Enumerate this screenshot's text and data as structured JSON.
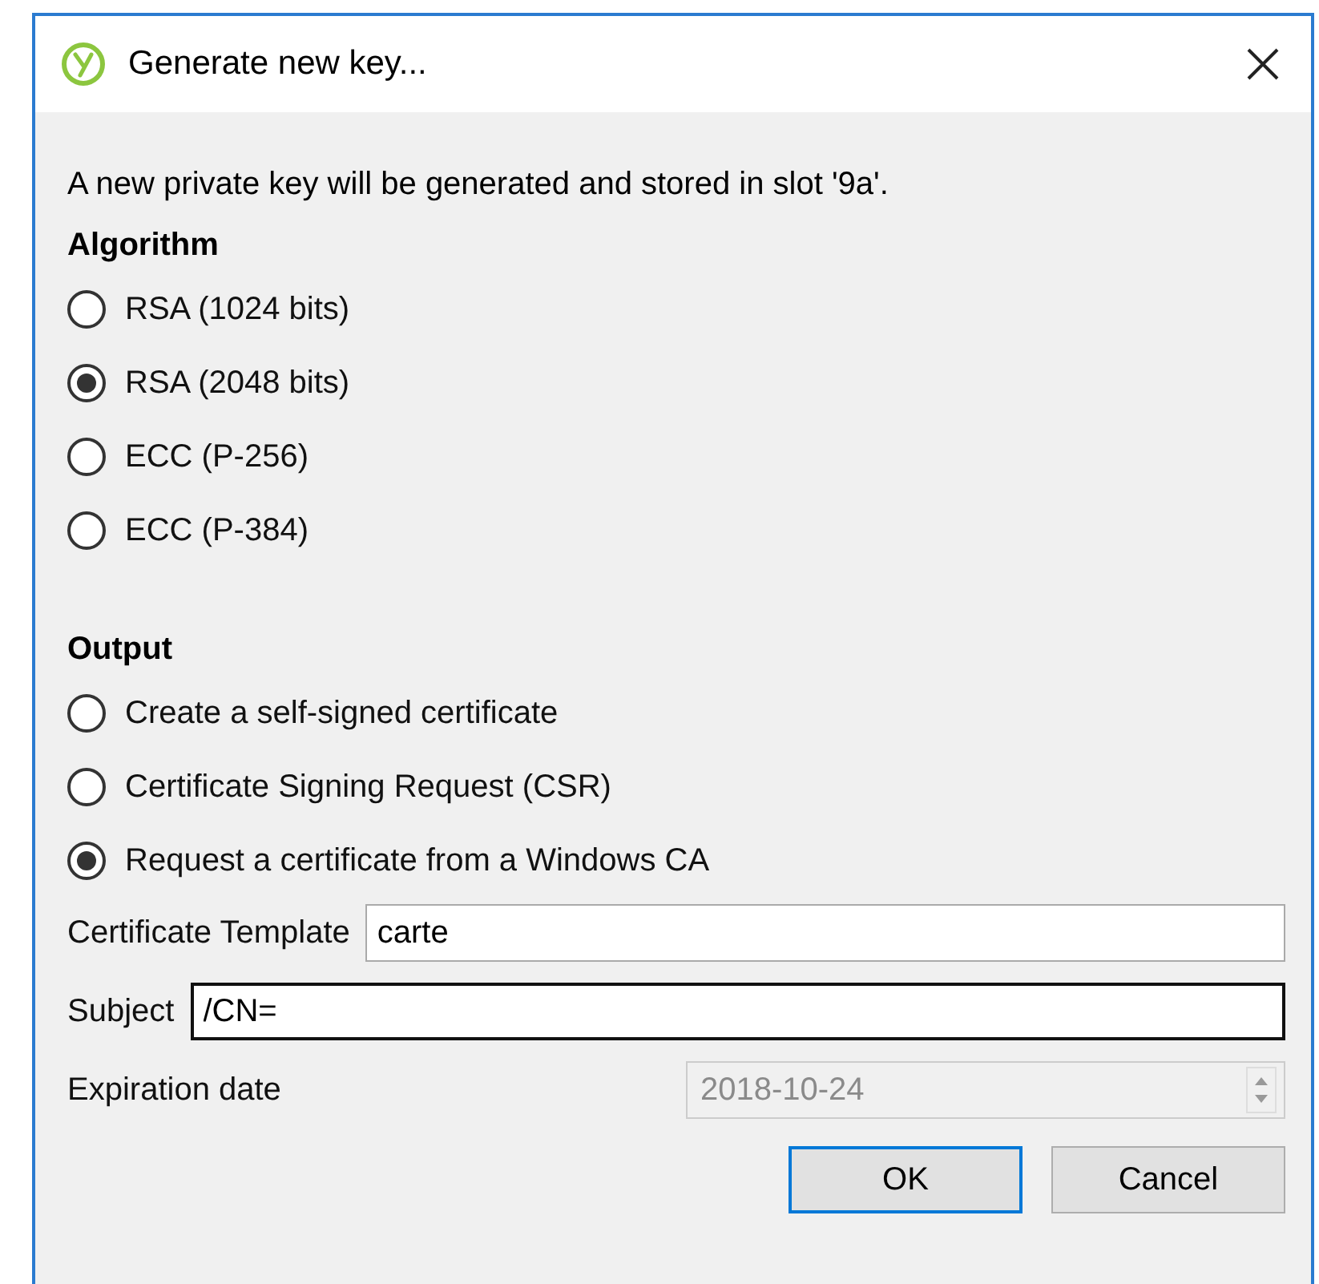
{
  "window": {
    "title": "Generate new key..."
  },
  "description": "A new private key will be generated and stored in slot '9a'.",
  "algorithm": {
    "heading": "Algorithm",
    "options": [
      {
        "label": "RSA (1024 bits)",
        "selected": false
      },
      {
        "label": "RSA (2048 bits)",
        "selected": true
      },
      {
        "label": "ECC (P-256)",
        "selected": false
      },
      {
        "label": "ECC (P-384)",
        "selected": false
      }
    ]
  },
  "output": {
    "heading": "Output",
    "options": [
      {
        "label": "Create a self-signed certificate",
        "selected": false
      },
      {
        "label": "Certificate Signing Request (CSR)",
        "selected": false
      },
      {
        "label": "Request a certificate from a Windows CA",
        "selected": true
      }
    ]
  },
  "fields": [
    {
      "label": "Certificate Template",
      "value": "carte",
      "focused": false,
      "disabled": false
    },
    {
      "label": "Subject",
      "value": "/CN=",
      "focused": true,
      "disabled": false
    }
  ],
  "expiration": {
    "label": "Expiration date",
    "value": "2018-10-24",
    "disabled": true
  },
  "buttons": [
    {
      "label": "OK",
      "default": true
    },
    {
      "label": "Cancel",
      "default": false
    }
  ]
}
